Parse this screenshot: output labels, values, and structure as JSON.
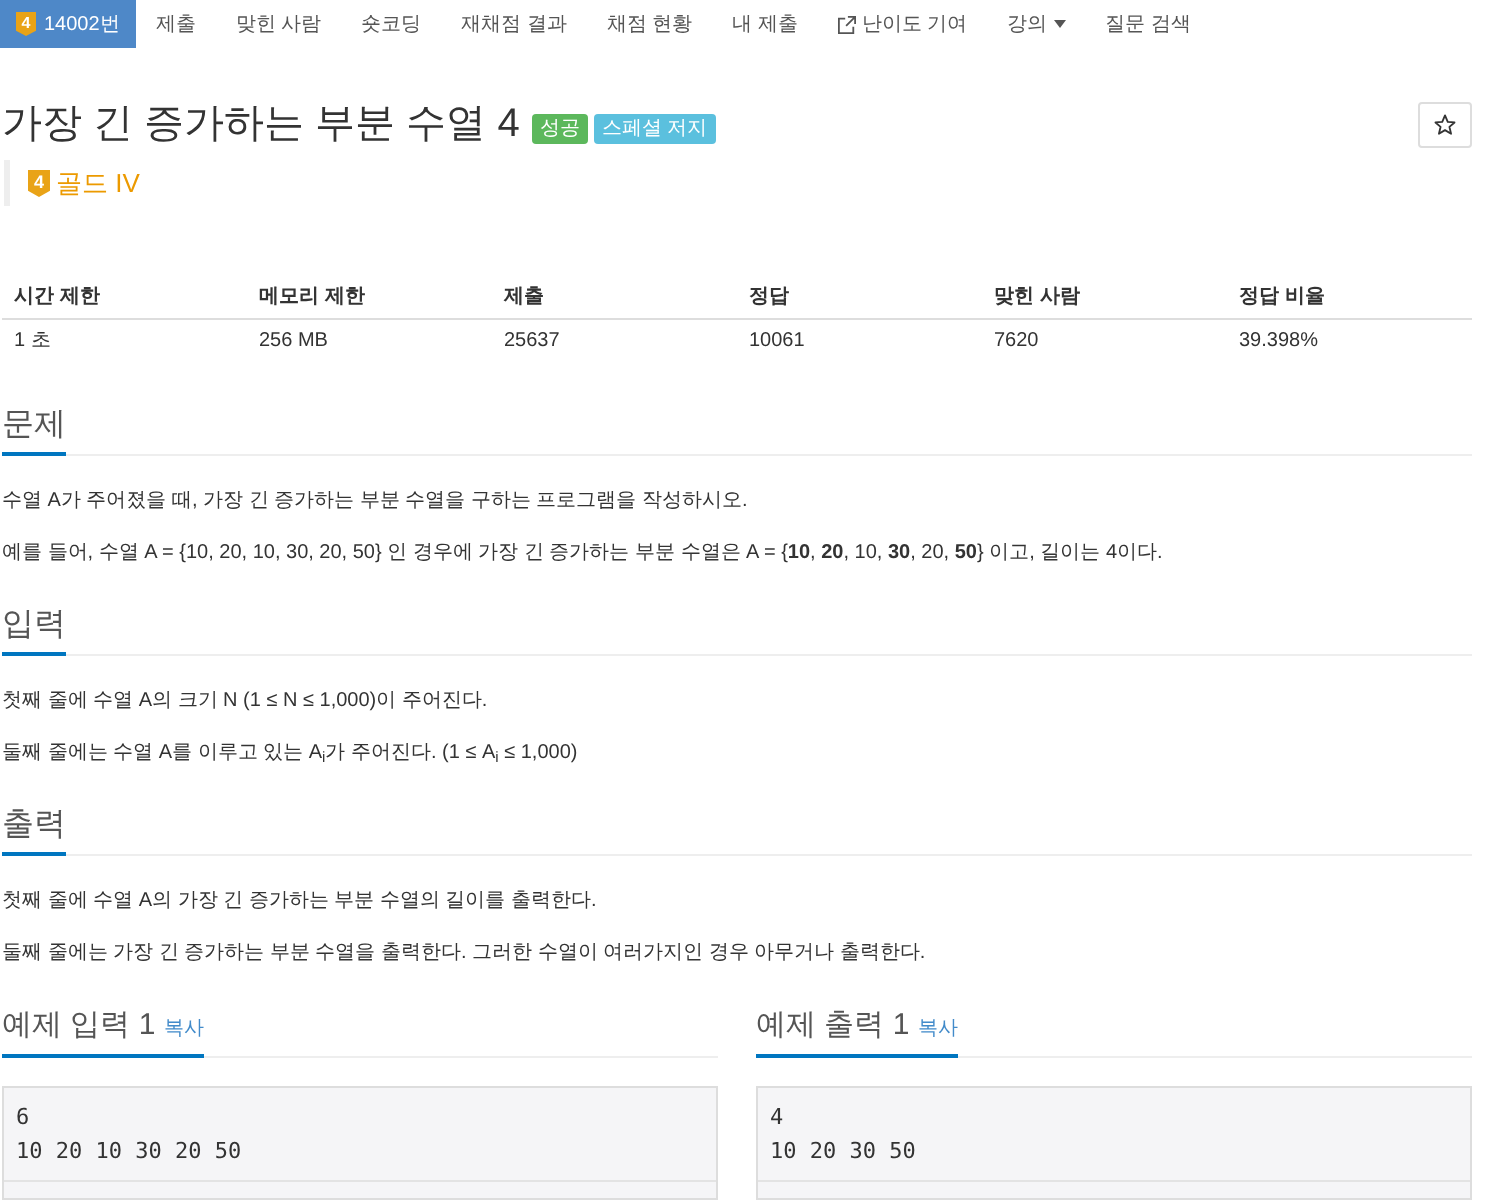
{
  "nav": {
    "items": [
      {
        "kind": "problem",
        "badge": "4",
        "label": "14002번",
        "selected": true
      },
      {
        "kind": "link",
        "label": "제출",
        "selected": false
      },
      {
        "kind": "link",
        "label": "맞힌 사람",
        "selected": false
      },
      {
        "kind": "link",
        "label": "숏코딩",
        "selected": false
      },
      {
        "kind": "link",
        "label": "재채점 결과",
        "selected": false
      },
      {
        "kind": "link",
        "label": "채점 현황",
        "selected": false
      },
      {
        "kind": "link",
        "label": "내 제출",
        "selected": false
      },
      {
        "kind": "external",
        "label": "난이도 기여",
        "selected": false
      },
      {
        "kind": "dropdown",
        "label": "강의",
        "selected": false
      },
      {
        "kind": "link",
        "label": "질문 검색",
        "selected": false
      }
    ]
  },
  "problem": {
    "title": "가장 긴 증가하는 부분 수열 4",
    "labels": [
      {
        "text": "성공",
        "color": "#5cb85c"
      },
      {
        "text": "스페셜 저지",
        "color": "#5bc0de"
      }
    ],
    "tier": {
      "badge": "4",
      "name": "골드 IV"
    }
  },
  "stats": {
    "columns": [
      "시간 제한",
      "메모리 제한",
      "제출",
      "정답",
      "맞힌 사람",
      "정답 비율"
    ],
    "rows": [
      [
        "1 초",
        "256 MB",
        "25637",
        "10061",
        "7620",
        "39.398%"
      ]
    ]
  },
  "sections": [
    {
      "heading": "문제",
      "paragraphs": [
        "수열 A가 주어졌을 때, 가장 긴 증가하는 부분 수열을 구하는 프로그램을 작성하시오.",
        "예를 들어, 수열 A = {10, 20, 10, 30, 20, 50} 인 경우에 가장 긴 증가하는 부분 수열은 A = {**10**, **20**, 10, **30**, 20, **50**} 이고, 길이는 4이다."
      ]
    },
    {
      "heading": "입력",
      "paragraphs": [
        "첫째 줄에 수열 A의 크기 N (1 ≤ N ≤ 1,000)이 주어진다.",
        "둘째 줄에는 수열 A를 이루고 있는 A$_{i}$가 주어진다. (1 ≤ A$_{i}$ ≤ 1,000)"
      ]
    },
    {
      "heading": "출력",
      "paragraphs": [
        "첫째 줄에 수열 A의 가장 긴 증가하는 부분 수열의 길이를 출력한다.",
        "둘째 줄에는 가장 긴 증가하는 부분 수열을 출력한다. 그러한 수열이 여러가지인 경우 아무거나 출력한다."
      ]
    }
  ],
  "samples": [
    {
      "title": "예제 입력 1",
      "copy": "복사",
      "text": "6\n10 20 10 30 20 50"
    },
    {
      "title": "예제 출력 1",
      "copy": "복사",
      "text": "4\n10 20 30 50"
    }
  ]
}
